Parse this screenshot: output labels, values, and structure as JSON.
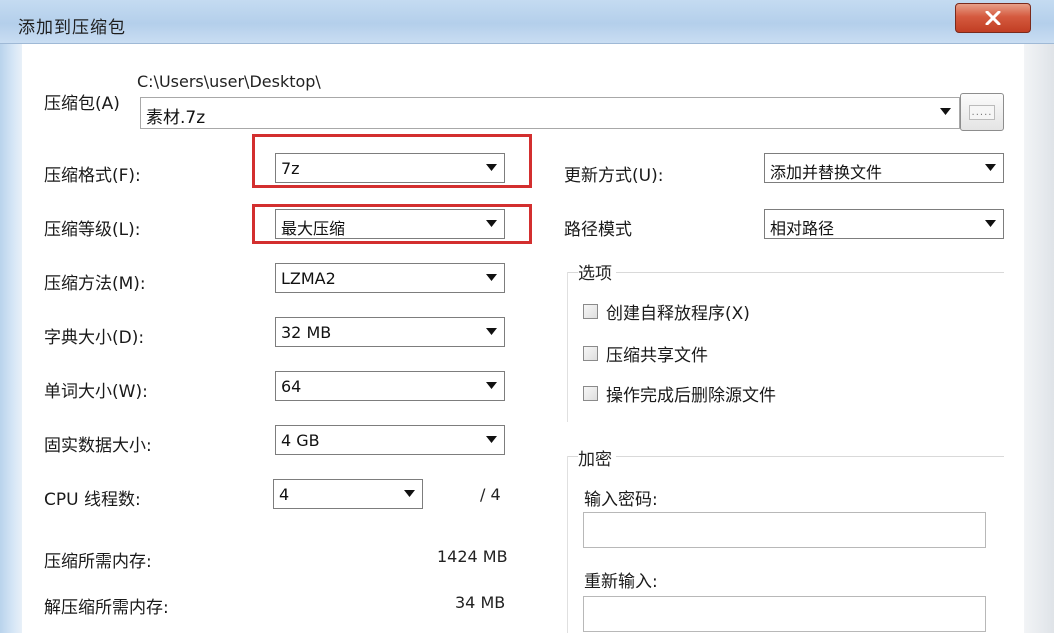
{
  "window": {
    "title": "添加到压缩包",
    "close_label": "X"
  },
  "archive": {
    "label": "压缩包(A)",
    "path": "C:\\Users\\user\\Desktop\\",
    "name": "素材.7z",
    "browse_label": "....."
  },
  "left": {
    "format": {
      "label": "压缩格式(F):",
      "value": "7z"
    },
    "level": {
      "label": "压缩等级(L):",
      "value": "最大压缩"
    },
    "method": {
      "label": "压缩方法(M):",
      "value": "LZMA2"
    },
    "dict": {
      "label": "字典大小(D):",
      "value": "32 MB"
    },
    "word": {
      "label": "单词大小(W):",
      "value": "64"
    },
    "solid": {
      "label": "固实数据大小:",
      "value": "4 GB"
    },
    "threads": {
      "label": "CPU 线程数:",
      "value": "4",
      "total": "/ 4"
    },
    "mem_compress": {
      "label": "压缩所需内存:",
      "value": "1424 MB"
    },
    "mem_decompress": {
      "label": "解压缩所需内存:",
      "value": "34 MB"
    }
  },
  "right": {
    "update": {
      "label": "更新方式(U):",
      "value": "添加并替换文件"
    },
    "path_mode": {
      "label": "路径模式",
      "value": "相对路径"
    },
    "options": {
      "title": "选项",
      "items": [
        {
          "label": "创建自释放程序(X)",
          "checked": false
        },
        {
          "label": "压缩共享文件",
          "checked": false
        },
        {
          "label": "操作完成后删除源文件",
          "checked": false
        }
      ]
    },
    "encryption": {
      "title": "加密",
      "password_label": "输入密码:",
      "confirm_label": "重新输入:"
    }
  },
  "colors": {
    "highlight": "#d32f2f",
    "title_bar": "#b4cfeb",
    "close_button": "#c13e23"
  }
}
